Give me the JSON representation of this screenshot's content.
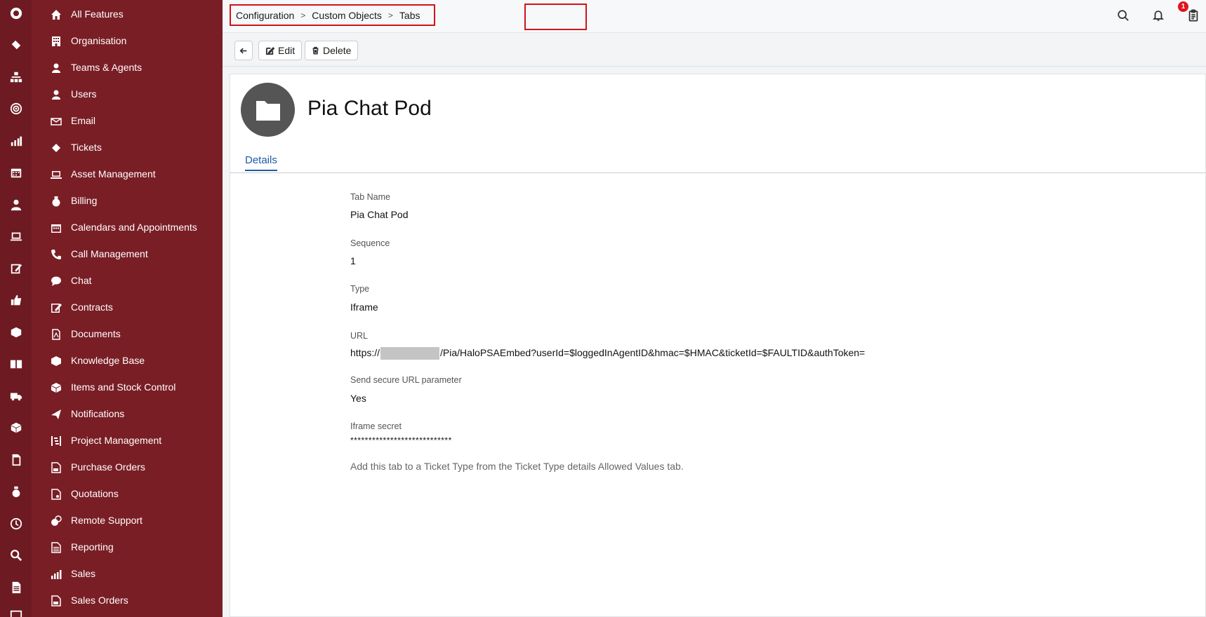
{
  "rail": {
    "icons": [
      "logo-icon",
      "ticket-icon",
      "org-chart-icon",
      "target-icon",
      "chart-icon",
      "calendar-icon",
      "user-icon",
      "laptop-icon",
      "edit-icon",
      "thumbs-up-icon",
      "box-icon",
      "book-icon",
      "truck-icon",
      "cube-icon",
      "document-icon",
      "money-bag-icon",
      "clock-icon",
      "search-icon",
      "report-icon",
      "monitor-icon"
    ]
  },
  "sidebar": {
    "items": [
      {
        "label": "All Features",
        "icon": "home-icon"
      },
      {
        "label": "Organisation",
        "icon": "building-icon"
      },
      {
        "label": "Teams & Agents",
        "icon": "agent-icon"
      },
      {
        "label": "Users",
        "icon": "user-icon"
      },
      {
        "label": "Email",
        "icon": "email-icon"
      },
      {
        "label": "Tickets",
        "icon": "ticket-icon"
      },
      {
        "label": "Asset Management",
        "icon": "laptop-icon"
      },
      {
        "label": "Billing",
        "icon": "money-bag-icon"
      },
      {
        "label": "Calendars and Appointments",
        "icon": "calendar-icon"
      },
      {
        "label": "Call Management",
        "icon": "phone-icon"
      },
      {
        "label": "Chat",
        "icon": "chat-icon"
      },
      {
        "label": "Contracts",
        "icon": "contract-icon"
      },
      {
        "label": "Documents",
        "icon": "pdf-icon"
      },
      {
        "label": "Knowledge Base",
        "icon": "knowledge-icon"
      },
      {
        "label": "Items and Stock Control",
        "icon": "box-icon"
      },
      {
        "label": "Notifications",
        "icon": "notification-icon"
      },
      {
        "label": "Project Management",
        "icon": "project-icon"
      },
      {
        "label": "Purchase Orders",
        "icon": "purchase-order-icon"
      },
      {
        "label": "Quotations",
        "icon": "quotation-icon"
      },
      {
        "label": "Remote Support",
        "icon": "remote-icon"
      },
      {
        "label": "Reporting",
        "icon": "report-icon"
      },
      {
        "label": "Sales",
        "icon": "sales-icon"
      },
      {
        "label": "Sales Orders",
        "icon": "sales-order-icon"
      }
    ]
  },
  "breadcrumb": {
    "items": [
      "Configuration",
      "Custom Objects",
      "Tabs"
    ],
    "separator": ">"
  },
  "topbar": {
    "notification_count": "1"
  },
  "toolbar": {
    "edit_label": "Edit",
    "delete_label": "Delete"
  },
  "record": {
    "title": "Pia Chat Pod",
    "tab": "Details",
    "fields": [
      {
        "label": "Tab Name",
        "value": "Pia Chat Pod"
      },
      {
        "label": "Sequence",
        "value": "1"
      },
      {
        "label": "Type",
        "value": "Iframe"
      },
      {
        "label": "URL",
        "value_prefix": "https://",
        "value_suffix": "/Pia/HaloPSAEmbed?userId=$loggedInAgentID&hmac=$HMAC&ticketId=$FAULTID&authToken="
      },
      {
        "label": "Send secure URL parameter",
        "value": "Yes"
      },
      {
        "label": "Iframe secret",
        "value": "****************************"
      }
    ],
    "hint": "Add this tab to a Ticket Type from the Ticket Type details Allowed Values tab."
  },
  "colors": {
    "rail_bg": "#6e1a22",
    "sidebar_bg": "#7a1e26",
    "highlight": "#d0131c",
    "tab_active": "#1e5aa8",
    "badge": "#e0141f"
  }
}
